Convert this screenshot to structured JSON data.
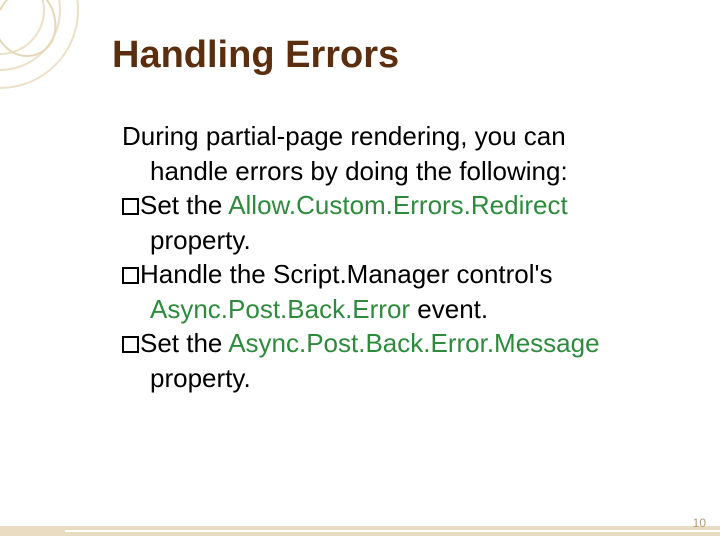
{
  "title": "Handling Errors",
  "intro1": "During partial-page rendering, you can",
  "intro2": "handle errors by doing the following:",
  "b1_a": "Set the ",
  "b1_link": "Allow.Custom.Errors.Redirect",
  "b1_b": "property.",
  "b2_a": "Handle the Script.Manager control's",
  "b2_link": "Async.Post.Back.Error",
  "b2_b": " event.",
  "b3_a": "Set the ",
  "b3_link": "Async.Post.Back.Error.Message",
  "b3_b": "property.",
  "page": "10"
}
